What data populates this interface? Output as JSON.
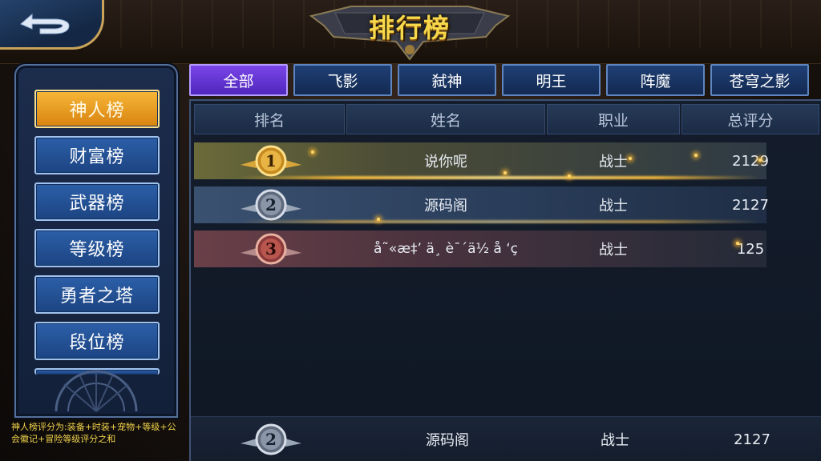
{
  "title": "排行榜",
  "tabs": [
    {
      "label": "全部",
      "active": true
    },
    {
      "label": "飞影",
      "active": false
    },
    {
      "label": "弑神",
      "active": false
    },
    {
      "label": "明王",
      "active": false
    },
    {
      "label": "阵魔",
      "active": false
    },
    {
      "label": "苍穹之影",
      "active": false
    }
  ],
  "sidebar": {
    "items": [
      {
        "label": "神人榜",
        "active": true
      },
      {
        "label": "财富榜",
        "active": false
      },
      {
        "label": "武器榜",
        "active": false
      },
      {
        "label": "等级榜",
        "active": false
      },
      {
        "label": "勇者之塔",
        "active": false
      },
      {
        "label": "段位榜",
        "active": false
      }
    ],
    "note": "神人榜评分为:装备+时装+宠物+等级+公会徽记+冒险等级评分之和"
  },
  "table": {
    "headers": [
      "排名",
      "姓名",
      "职业",
      "总评分"
    ],
    "rows": [
      {
        "rank": "1",
        "name": "说你呢",
        "job": "战士",
        "score": "2129",
        "medal": "gold"
      },
      {
        "rank": "2",
        "name": "源码阁",
        "job": "战士",
        "score": "2127",
        "medal": "silver"
      },
      {
        "rank": "3",
        "name": "å˜«æ‡’ ä¸ è¯´ä½ å ‘ç",
        "job": "战士",
        "score": "125",
        "medal": "bronze"
      }
    ],
    "self_row": {
      "rank": "2",
      "name": "源码阁",
      "job": "战士",
      "score": "2127"
    }
  },
  "colors": {
    "accent_gold": "#f6b636",
    "accent_purple": "#6a3ad8",
    "tab_blue": "#1f3f74",
    "title_yellow": "#f6d84a"
  }
}
